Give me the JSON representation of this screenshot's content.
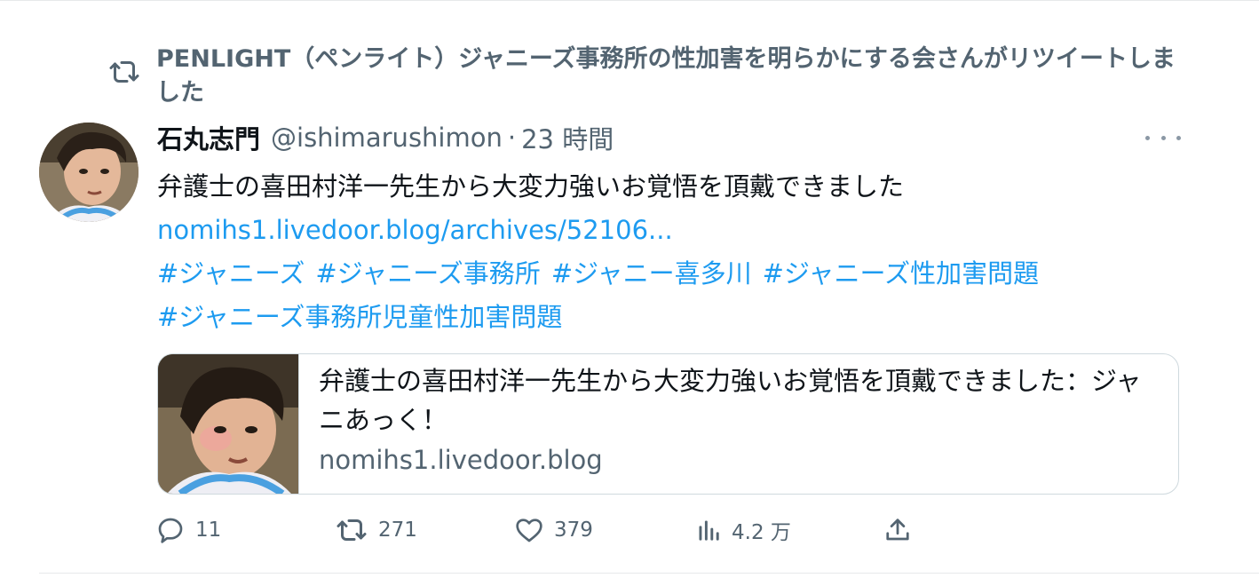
{
  "retweet": {
    "icon": "retweet-icon",
    "text": "PENLIGHT（ペンライト）ジャニーズ事務所の性加害を明らかにする会さんがリツイートしました"
  },
  "tweet": {
    "display_name": "石丸志門",
    "handle": "@ishimarushimon",
    "separator": "·",
    "time": "23 時間",
    "text": "弁護士の喜田村洋一先生から大変力強いお覚悟を頂戴できました",
    "link": "nomihs1.livedoor.blog/archives/52106...",
    "hashtags": [
      "#ジャニーズ",
      "#ジャニーズ事務所",
      "#ジャニー喜多川",
      "#ジャニーズ性加害問題",
      "#ジャニーズ事務所児童性加害問題"
    ]
  },
  "card": {
    "title": "弁護士の喜田村洋一先生から大変力強いお覚悟を頂戴できました：ジャニあっく！",
    "domain": "nomihs1.livedoor.blog"
  },
  "actions": {
    "replies": "11",
    "retweets": "271",
    "likes": "379",
    "views": "4.2 万"
  },
  "colors": {
    "link": "#1d9bf0",
    "secondary_text": "#536471",
    "primary_text": "#0f1419",
    "border": "#cfd9de"
  }
}
